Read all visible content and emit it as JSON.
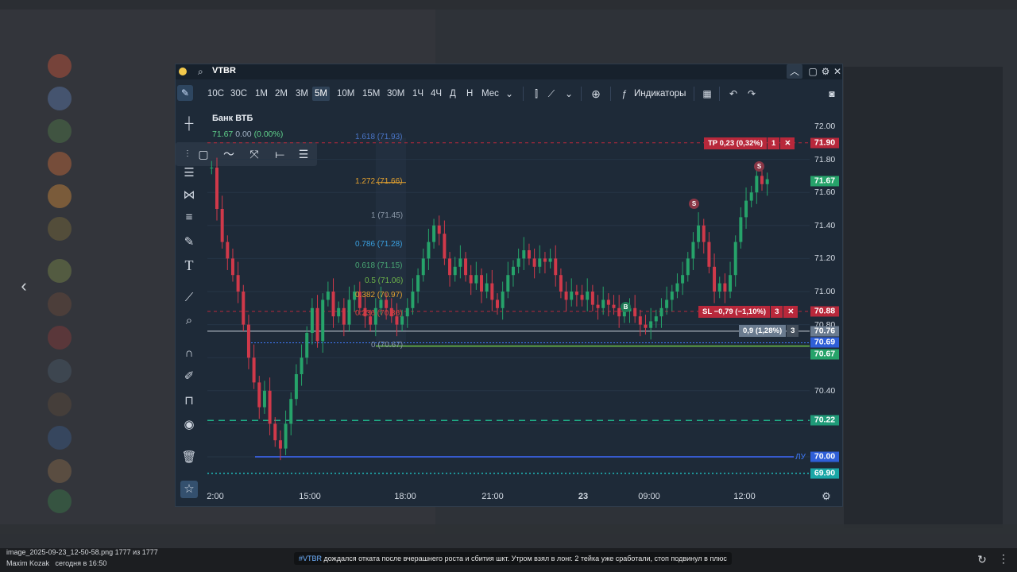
{
  "window": {
    "symbol": "VTBR",
    "instrument_name": "Банк ВТБ",
    "last": "71.67",
    "change": "0.00",
    "change_pct": "(0.00%)"
  },
  "toolbar": {
    "timeframes": [
      "10С",
      "30С",
      "1М",
      "2М",
      "3М",
      "5М",
      "10М",
      "15М",
      "30М",
      "1Ч",
      "4Ч",
      "Д",
      "Н",
      "Мес"
    ],
    "active_timeframe": "5М",
    "indicators_label": "Индикаторы"
  },
  "fib_levels": [
    {
      "label": "1.618 (71.93)",
      "color": "#4a76c9"
    },
    {
      "label": "1.272 (71.66)",
      "color": "#e3a12f"
    },
    {
      "label": "1 (71.45)",
      "color": "#8b98a8"
    },
    {
      "label": "0.786 (71.28)",
      "color": "#3aa0e0"
    },
    {
      "label": "0.618 (71.15)",
      "color": "#49a875"
    },
    {
      "label": "0.5 (71.06)",
      "color": "#6fb64a"
    },
    {
      "label": "0.382 (70.97)",
      "color": "#e3a12f"
    },
    {
      "label": "0.236 (70.86)",
      "color": "#d0453f"
    },
    {
      "label": "0 (70.67)",
      "color": "#8b98a8"
    }
  ],
  "orders": {
    "tp": {
      "label": "TP 0,23 (0,32%)",
      "qty": "1",
      "price": "71.90"
    },
    "sl": {
      "label": "SL −0,79 (−1,10%)",
      "qty": "3",
      "price": "70.88"
    },
    "position": {
      "label": "0,9 (1,28%)",
      "qty": "3",
      "price": "70.76"
    }
  },
  "price_axis": {
    "ticks": [
      "72.00",
      "71.80",
      "71.60",
      "71.40",
      "71.20",
      "71.00",
      "70.80",
      "70.40"
    ],
    "tags": [
      {
        "price": "71.67",
        "color": "#26a36a"
      },
      {
        "price": "70.69",
        "color": "#2f5fd8"
      },
      {
        "price": "70.67",
        "color": "#26a36a"
      },
      {
        "price": "70.22",
        "color": "#1f9a78"
      },
      {
        "price": "70.00",
        "color": "#2f5fd8"
      },
      {
        "price": "69.90",
        "color": "#1aa7a7"
      }
    ],
    "level_label": "ЛУ"
  },
  "time_axis": [
    "2:00",
    "15:00",
    "18:00",
    "21:00",
    "23",
    "09:00",
    "12:00"
  ],
  "markers": [
    "S",
    "S",
    "B"
  ],
  "viewer": {
    "filename": "image_2025-09-23_12-50-58.png 1777 из 1777",
    "author": "Maxim Kozak",
    "date": "сегодня в 16:50",
    "hashtag": "#VTBR",
    "caption": " дождался отката после вчерашнего роста и сбития шкт. Утром взял в лонг. 2 тейка уже сработали, стоп подвинул в плюс"
  },
  "colors": {
    "bull": "#26a36a",
    "bear": "#d0394a",
    "bg": "#1e2a38"
  }
}
